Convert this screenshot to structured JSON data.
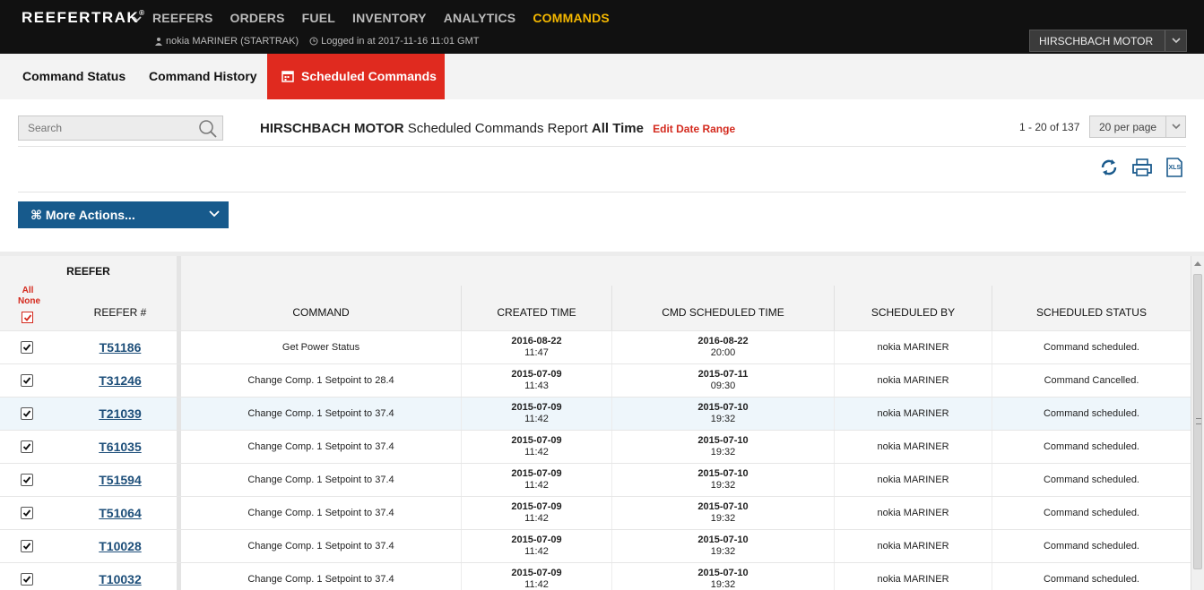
{
  "app": {
    "brand": "REEFERTRAK",
    "brand_mark": "®",
    "nav": [
      "REEFERS",
      "ORDERS",
      "FUEL",
      "INVENTORY",
      "ANALYTICS",
      "COMMANDS"
    ],
    "active_nav": "COMMANDS",
    "user": "nokia MARINER (STARTRAK)",
    "login": "Logged in at 2017-11-16 11:01 GMT",
    "company": "HIRSCHBACH MOTOR"
  },
  "tabs": {
    "status": "Command Status",
    "history": "Command History",
    "scheduled": "Scheduled Commands"
  },
  "toolbar": {
    "search_placeholder": "Search",
    "report_company": "HIRSCHBACH MOTOR",
    "report_name": "Scheduled Commands Report",
    "report_range": "All Time",
    "edit_range": "Edit Date Range",
    "pager": "1 - 20 of 137",
    "per_page": "20 per page",
    "more_actions": "⌘ More Actions..."
  },
  "table": {
    "group_header": "REEFER",
    "select_all": "All",
    "select_none": "None",
    "headers": {
      "reefer": "REEFER #",
      "command": "COMMAND",
      "created": "CREATED TIME",
      "scheduled": "CMD SCHEDULED TIME",
      "by": "SCHEDULED BY",
      "status": "SCHEDULED STATUS"
    },
    "rows": [
      {
        "reefer": "T51186",
        "command": "Get Power Status",
        "created_date": "2016-08-22",
        "created_time": "11:47",
        "sched_date": "2016-08-22",
        "sched_time": "20:00",
        "by": "nokia MARINER",
        "status": "Command scheduled."
      },
      {
        "reefer": "T31246",
        "command": "Change Comp. 1 Setpoint to 28.4",
        "created_date": "2015-07-09",
        "created_time": "11:43",
        "sched_date": "2015-07-11",
        "sched_time": "09:30",
        "by": "nokia MARINER",
        "status": "Command Cancelled."
      },
      {
        "reefer": "T21039",
        "command": "Change Comp. 1 Setpoint to 37.4",
        "created_date": "2015-07-09",
        "created_time": "11:42",
        "sched_date": "2015-07-10",
        "sched_time": "19:32",
        "by": "nokia MARINER",
        "status": "Command scheduled."
      },
      {
        "reefer": "T61035",
        "command": "Change Comp. 1 Setpoint to 37.4",
        "created_date": "2015-07-09",
        "created_time": "11:42",
        "sched_date": "2015-07-10",
        "sched_time": "19:32",
        "by": "nokia MARINER",
        "status": "Command scheduled."
      },
      {
        "reefer": "T51594",
        "command": "Change Comp. 1 Setpoint to 37.4",
        "created_date": "2015-07-09",
        "created_time": "11:42",
        "sched_date": "2015-07-10",
        "sched_time": "19:32",
        "by": "nokia MARINER",
        "status": "Command scheduled."
      },
      {
        "reefer": "T51064",
        "command": "Change Comp. 1 Setpoint to 37.4",
        "created_date": "2015-07-09",
        "created_time": "11:42",
        "sched_date": "2015-07-10",
        "sched_time": "19:32",
        "by": "nokia MARINER",
        "status": "Command scheduled."
      },
      {
        "reefer": "T10028",
        "command": "Change Comp. 1 Setpoint to 37.4",
        "created_date": "2015-07-09",
        "created_time": "11:42",
        "sched_date": "2015-07-10",
        "sched_time": "19:32",
        "by": "nokia MARINER",
        "status": "Command scheduled."
      },
      {
        "reefer": "T10032",
        "command": "Change Comp. 1 Setpoint to 37.4",
        "created_date": "2015-07-09",
        "created_time": "11:42",
        "sched_date": "2015-07-10",
        "sched_time": "19:32",
        "by": "nokia MARINER",
        "status": "Command scheduled."
      }
    ]
  },
  "colors": {
    "accent": "#e02a1f",
    "nav_active": "#f5b800",
    "primary_button": "#175a8c",
    "link": "#1e4f7a",
    "topbar": "#111111"
  }
}
